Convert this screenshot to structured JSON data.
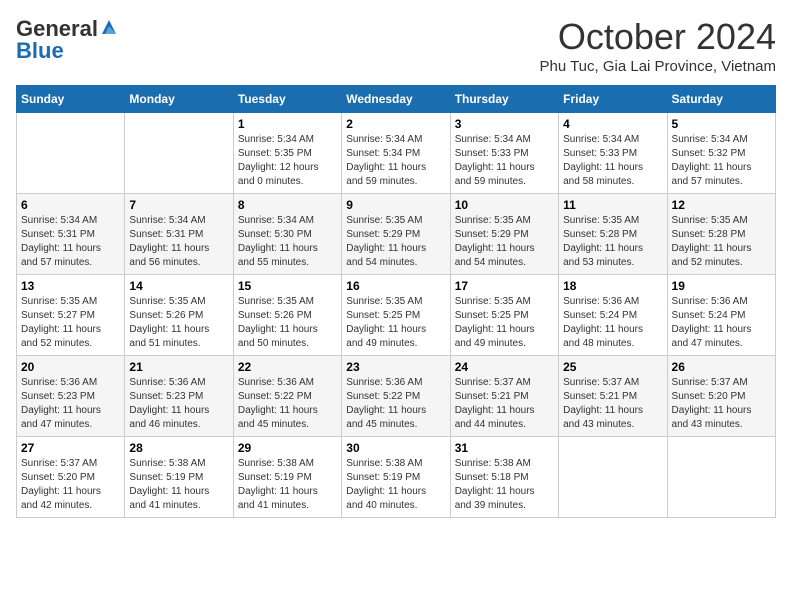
{
  "header": {
    "logo_general": "General",
    "logo_blue": "Blue",
    "month": "October 2024",
    "location": "Phu Tuc, Gia Lai Province, Vietnam"
  },
  "weekdays": [
    "Sunday",
    "Monday",
    "Tuesday",
    "Wednesday",
    "Thursday",
    "Friday",
    "Saturday"
  ],
  "weeks": [
    [
      {
        "day": "",
        "info": ""
      },
      {
        "day": "",
        "info": ""
      },
      {
        "day": "1",
        "info": "Sunrise: 5:34 AM\nSunset: 5:35 PM\nDaylight: 12 hours\nand 0 minutes."
      },
      {
        "day": "2",
        "info": "Sunrise: 5:34 AM\nSunset: 5:34 PM\nDaylight: 11 hours\nand 59 minutes."
      },
      {
        "day": "3",
        "info": "Sunrise: 5:34 AM\nSunset: 5:33 PM\nDaylight: 11 hours\nand 59 minutes."
      },
      {
        "day": "4",
        "info": "Sunrise: 5:34 AM\nSunset: 5:33 PM\nDaylight: 11 hours\nand 58 minutes."
      },
      {
        "day": "5",
        "info": "Sunrise: 5:34 AM\nSunset: 5:32 PM\nDaylight: 11 hours\nand 57 minutes."
      }
    ],
    [
      {
        "day": "6",
        "info": "Sunrise: 5:34 AM\nSunset: 5:31 PM\nDaylight: 11 hours\nand 57 minutes."
      },
      {
        "day": "7",
        "info": "Sunrise: 5:34 AM\nSunset: 5:31 PM\nDaylight: 11 hours\nand 56 minutes."
      },
      {
        "day": "8",
        "info": "Sunrise: 5:34 AM\nSunset: 5:30 PM\nDaylight: 11 hours\nand 55 minutes."
      },
      {
        "day": "9",
        "info": "Sunrise: 5:35 AM\nSunset: 5:29 PM\nDaylight: 11 hours\nand 54 minutes."
      },
      {
        "day": "10",
        "info": "Sunrise: 5:35 AM\nSunset: 5:29 PM\nDaylight: 11 hours\nand 54 minutes."
      },
      {
        "day": "11",
        "info": "Sunrise: 5:35 AM\nSunset: 5:28 PM\nDaylight: 11 hours\nand 53 minutes."
      },
      {
        "day": "12",
        "info": "Sunrise: 5:35 AM\nSunset: 5:28 PM\nDaylight: 11 hours\nand 52 minutes."
      }
    ],
    [
      {
        "day": "13",
        "info": "Sunrise: 5:35 AM\nSunset: 5:27 PM\nDaylight: 11 hours\nand 52 minutes."
      },
      {
        "day": "14",
        "info": "Sunrise: 5:35 AM\nSunset: 5:26 PM\nDaylight: 11 hours\nand 51 minutes."
      },
      {
        "day": "15",
        "info": "Sunrise: 5:35 AM\nSunset: 5:26 PM\nDaylight: 11 hours\nand 50 minutes."
      },
      {
        "day": "16",
        "info": "Sunrise: 5:35 AM\nSunset: 5:25 PM\nDaylight: 11 hours\nand 49 minutes."
      },
      {
        "day": "17",
        "info": "Sunrise: 5:35 AM\nSunset: 5:25 PM\nDaylight: 11 hours\nand 49 minutes."
      },
      {
        "day": "18",
        "info": "Sunrise: 5:36 AM\nSunset: 5:24 PM\nDaylight: 11 hours\nand 48 minutes."
      },
      {
        "day": "19",
        "info": "Sunrise: 5:36 AM\nSunset: 5:24 PM\nDaylight: 11 hours\nand 47 minutes."
      }
    ],
    [
      {
        "day": "20",
        "info": "Sunrise: 5:36 AM\nSunset: 5:23 PM\nDaylight: 11 hours\nand 47 minutes."
      },
      {
        "day": "21",
        "info": "Sunrise: 5:36 AM\nSunset: 5:23 PM\nDaylight: 11 hours\nand 46 minutes."
      },
      {
        "day": "22",
        "info": "Sunrise: 5:36 AM\nSunset: 5:22 PM\nDaylight: 11 hours\nand 45 minutes."
      },
      {
        "day": "23",
        "info": "Sunrise: 5:36 AM\nSunset: 5:22 PM\nDaylight: 11 hours\nand 45 minutes."
      },
      {
        "day": "24",
        "info": "Sunrise: 5:37 AM\nSunset: 5:21 PM\nDaylight: 11 hours\nand 44 minutes."
      },
      {
        "day": "25",
        "info": "Sunrise: 5:37 AM\nSunset: 5:21 PM\nDaylight: 11 hours\nand 43 minutes."
      },
      {
        "day": "26",
        "info": "Sunrise: 5:37 AM\nSunset: 5:20 PM\nDaylight: 11 hours\nand 43 minutes."
      }
    ],
    [
      {
        "day": "27",
        "info": "Sunrise: 5:37 AM\nSunset: 5:20 PM\nDaylight: 11 hours\nand 42 minutes."
      },
      {
        "day": "28",
        "info": "Sunrise: 5:38 AM\nSunset: 5:19 PM\nDaylight: 11 hours\nand 41 minutes."
      },
      {
        "day": "29",
        "info": "Sunrise: 5:38 AM\nSunset: 5:19 PM\nDaylight: 11 hours\nand 41 minutes."
      },
      {
        "day": "30",
        "info": "Sunrise: 5:38 AM\nSunset: 5:19 PM\nDaylight: 11 hours\nand 40 minutes."
      },
      {
        "day": "31",
        "info": "Sunrise: 5:38 AM\nSunset: 5:18 PM\nDaylight: 11 hours\nand 39 minutes."
      },
      {
        "day": "",
        "info": ""
      },
      {
        "day": "",
        "info": ""
      }
    ]
  ]
}
